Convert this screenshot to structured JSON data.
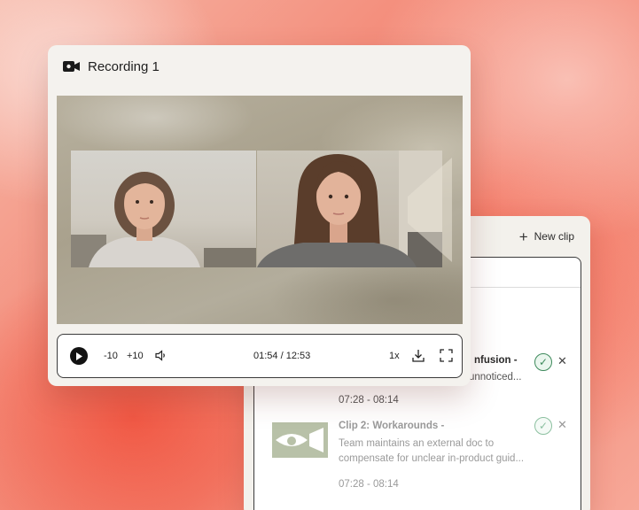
{
  "recording": {
    "title": "Recording 1",
    "controls": {
      "rewind_label": "-10",
      "forward_label": "+10",
      "time": "01:54 / 12:53",
      "speed": "1x"
    }
  },
  "clips_panel": {
    "new_clip_label": "New clip",
    "clips": [
      {
        "title_visible": "nfusion -",
        "desc_visible": "unnoticed...",
        "time": "07:28 - 08:14"
      },
      {
        "title": "Clip 2: Workarounds -",
        "desc": "Team maintains an external doc to compensate for unclear in-product guid...",
        "time": "07:28 - 08:14"
      }
    ]
  },
  "colors": {
    "accent_green": "#3e8a5c",
    "thumb_green": "#b8c1a8",
    "panel_bg": "#f4f2ee"
  },
  "icons": {
    "recording": "video-camera-icon",
    "play": "play-icon",
    "volume": "volume-icon",
    "download": "download-icon",
    "fullscreen": "fullscreen-icon",
    "add": "plus-icon",
    "approve": "check-icon",
    "dismiss": "close-icon"
  }
}
